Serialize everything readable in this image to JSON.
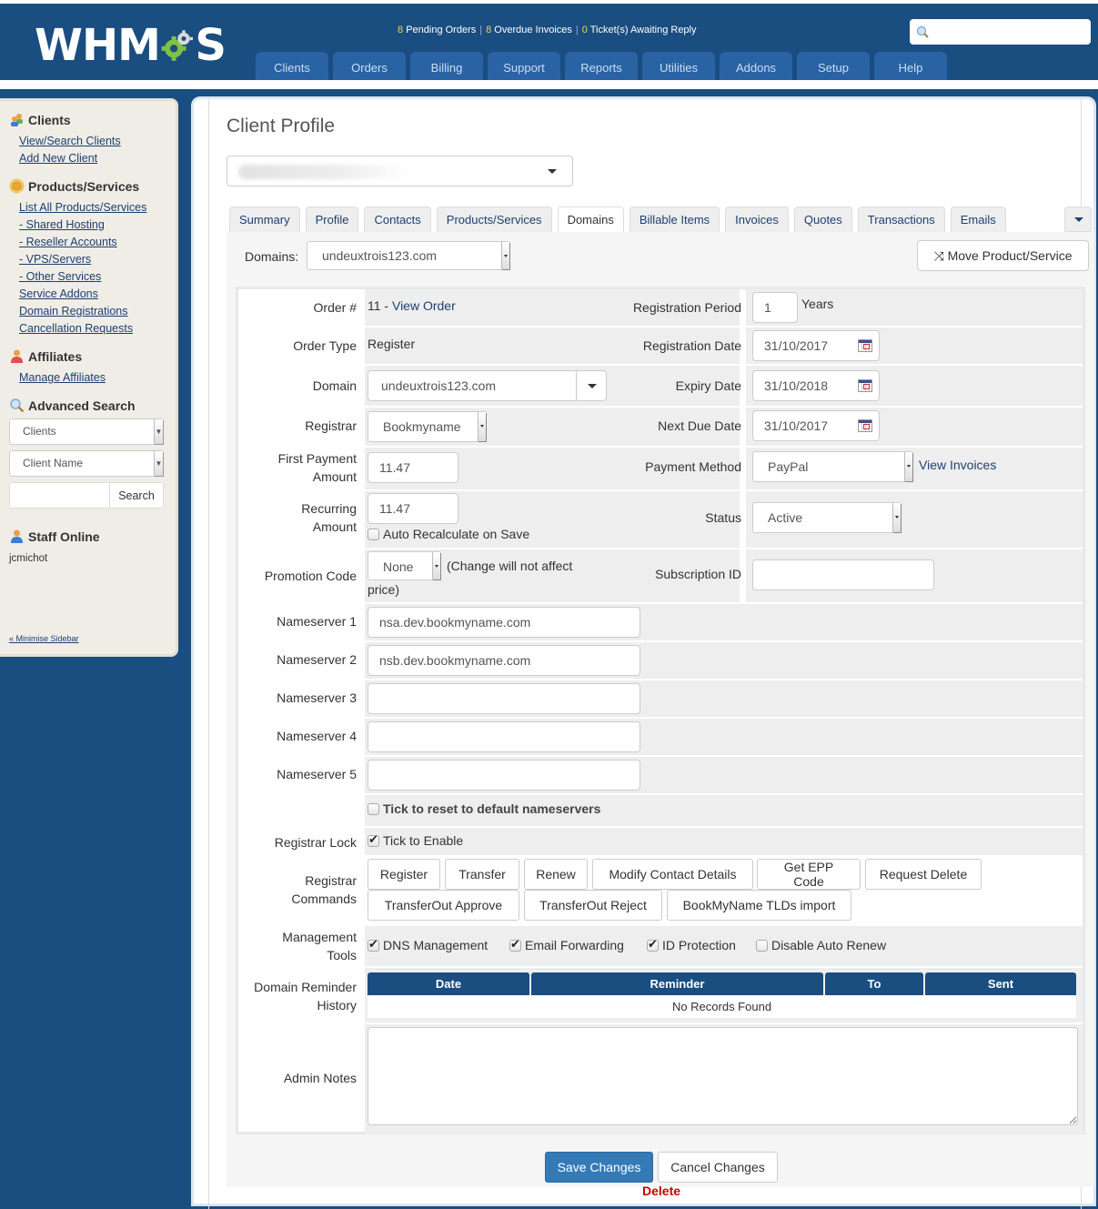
{
  "header": {
    "logo_text_a": "WHM",
    "logo_text_b": "S",
    "stats": [
      {
        "count": "8",
        "label": "Pending Orders"
      },
      {
        "count": "8",
        "label": "Overdue Invoices"
      },
      {
        "count": "0",
        "label": "Ticket(s) Awaiting Reply"
      }
    ],
    "search_placeholder": "",
    "nav": [
      "Clients",
      "Orders",
      "Billing",
      "Support",
      "Reports",
      "Utilities",
      "Addons",
      "Setup",
      "Help"
    ]
  },
  "sidebar": {
    "clients": {
      "title": "Clients",
      "links": [
        "View/Search Clients",
        "Add New Client"
      ]
    },
    "products": {
      "title": "Products/Services",
      "links": [
        "List All Products/Services",
        "- Shared Hosting",
        "- Reseller Accounts",
        "- VPS/Servers",
        "- Other Services",
        "Service Addons",
        "Domain Registrations",
        "Cancellation Requests"
      ]
    },
    "affiliates": {
      "title": "Affiliates",
      "links": [
        "Manage Affiliates"
      ]
    },
    "advanced_search": {
      "title": "Advanced Search",
      "type_select": "Clients",
      "field_select": "Client Name",
      "query": "",
      "button": "Search"
    },
    "staff": {
      "title": "Staff Online",
      "users": [
        "jcmichot"
      ]
    },
    "minimise": "« Minimise Sidebar"
  },
  "main": {
    "title": "Client Profile",
    "client_select_value": "",
    "tabs": [
      "Summary",
      "Profile",
      "Contacts",
      "Products/Services",
      "Domains",
      "Billable Items",
      "Invoices",
      "Quotes",
      "Transactions",
      "Emails"
    ],
    "active_tab": "Domains",
    "domains_label": "Domains:",
    "domains_value": "undeuxtrois123.com",
    "move_button": "Move Product/Service",
    "form": {
      "order_label": "Order #",
      "order_value": "11 - ",
      "order_link": "View Order",
      "order_type_label": "Order Type",
      "order_type_value": "Register",
      "domain_label": "Domain",
      "domain_value": "undeuxtrois123.com",
      "registrar_label": "Registrar",
      "registrar_value": "Bookmyname",
      "first_payment_label_1": "First Payment",
      "first_payment_label_2": "Amount",
      "first_payment_value": "11.47",
      "recurring_label_1": "Recurring",
      "recurring_label_2": "Amount",
      "recurring_value": "11.47",
      "auto_recalc_label": "Auto Recalculate on Save",
      "auto_recalc_checked": false,
      "promo_label": "Promotion Code",
      "promo_value": "None",
      "promo_note_1": "(Change will not affect",
      "promo_note_2": "price)",
      "reg_period_label": "Registration Period",
      "reg_period_value": "1",
      "reg_period_unit": "Years",
      "reg_date_label": "Registration Date",
      "reg_date_value": "31/10/2017",
      "expiry_label": "Expiry Date",
      "expiry_value": "31/10/2018",
      "next_due_label": "Next Due Date",
      "next_due_value": "31/10/2017",
      "payment_method_label": "Payment Method",
      "payment_method_value": "PayPal",
      "view_invoices": "View Invoices",
      "status_label": "Status",
      "status_value": "Active",
      "subscription_label": "Subscription ID",
      "subscription_value": "",
      "nameservers": [
        {
          "label": "Nameserver 1",
          "value": "nsa.dev.bookmyname.com"
        },
        {
          "label": "Nameserver 2",
          "value": "nsb.dev.bookmyname.com"
        },
        {
          "label": "Nameserver 3",
          "value": ""
        },
        {
          "label": "Nameserver 4",
          "value": ""
        },
        {
          "label": "Nameserver 5",
          "value": ""
        }
      ],
      "reset_ns_label": "Tick to reset to default nameservers",
      "reg_lock_label": "Registrar Lock",
      "reg_lock_text": "Tick to Enable",
      "reg_lock_checked": true,
      "commands_label_1": "Registrar",
      "commands_label_2": "Commands",
      "commands": [
        "Register",
        "Transfer",
        "Renew",
        "Modify Contact Details",
        "Get EPP Code",
        "Request Delete",
        "TransferOut Approve",
        "TransferOut Reject",
        "BookMyName TLDs import"
      ],
      "mgmt_label_1": "Management",
      "mgmt_label_2": "Tools",
      "mgmt_tools": [
        {
          "label": "DNS Management",
          "checked": true
        },
        {
          "label": "Email Forwarding",
          "checked": true
        },
        {
          "label": "ID Protection",
          "checked": true
        },
        {
          "label": "Disable Auto Renew",
          "checked": false
        }
      ],
      "reminder_label_1": "Domain Reminder",
      "reminder_label_2": "History",
      "reminder_columns": [
        "Date",
        "Reminder",
        "To",
        "Sent"
      ],
      "reminder_empty": "No Records Found",
      "notes_label": "Admin Notes",
      "notes_value": ""
    },
    "save_button": "Save Changes",
    "cancel_button": "Cancel Changes",
    "delete_link": "Delete"
  }
}
